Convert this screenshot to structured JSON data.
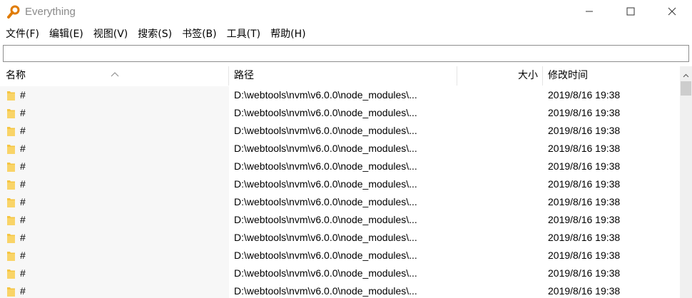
{
  "window": {
    "title": "Everything",
    "icon": "magnifier-app-icon"
  },
  "menu": {
    "items": [
      {
        "label": "文件(F)"
      },
      {
        "label": "编辑(E)"
      },
      {
        "label": "视图(V)"
      },
      {
        "label": "搜索(S)"
      },
      {
        "label": "书签(B)"
      },
      {
        "label": "工具(T)"
      },
      {
        "label": "帮助(H)"
      }
    ]
  },
  "search": {
    "value": "",
    "placeholder": ""
  },
  "columns": {
    "name": "名称",
    "path": "路径",
    "size": "大小",
    "date": "修改时间",
    "sorted_by": "name",
    "sort_direction": "ascending"
  },
  "rows": [
    {
      "name": "#",
      "path": "D:\\webtools\\nvm\\v6.0.0\\node_modules\\...",
      "size": "",
      "date": "2019/8/16 19:38"
    },
    {
      "name": "#",
      "path": "D:\\webtools\\nvm\\v6.0.0\\node_modules\\...",
      "size": "",
      "date": "2019/8/16 19:38"
    },
    {
      "name": "#",
      "path": "D:\\webtools\\nvm\\v6.0.0\\node_modules\\...",
      "size": "",
      "date": "2019/8/16 19:38"
    },
    {
      "name": "#",
      "path": "D:\\webtools\\nvm\\v6.0.0\\node_modules\\...",
      "size": "",
      "date": "2019/8/16 19:38"
    },
    {
      "name": "#",
      "path": "D:\\webtools\\nvm\\v6.0.0\\node_modules\\...",
      "size": "",
      "date": "2019/8/16 19:38"
    },
    {
      "name": "#",
      "path": "D:\\webtools\\nvm\\v6.0.0\\node_modules\\...",
      "size": "",
      "date": "2019/8/16 19:38"
    },
    {
      "name": "#",
      "path": "D:\\webtools\\nvm\\v6.0.0\\node_modules\\...",
      "size": "",
      "date": "2019/8/16 19:38"
    },
    {
      "name": "#",
      "path": "D:\\webtools\\nvm\\v6.0.0\\node_modules\\...",
      "size": "",
      "date": "2019/8/16 19:38"
    },
    {
      "name": "#",
      "path": "D:\\webtools\\nvm\\v6.0.0\\node_modules\\...",
      "size": "",
      "date": "2019/8/16 19:38"
    },
    {
      "name": "#",
      "path": "D:\\webtools\\nvm\\v6.0.0\\node_modules\\...",
      "size": "",
      "date": "2019/8/16 19:38"
    },
    {
      "name": "#",
      "path": "D:\\webtools\\nvm\\v6.0.0\\node_modules\\...",
      "size": "",
      "date": "2019/8/16 19:38"
    },
    {
      "name": "#",
      "path": "D:\\webtools\\nvm\\v6.0.0\\node_modules\\...",
      "size": "",
      "date": "2019/8/16 19:38"
    }
  ],
  "colors": {
    "folder": "#f5c542",
    "app_icon": "#e07b00",
    "title_text": "#8a8a8a",
    "name_column_bg": "#f7f7f7",
    "scrollbar_thumb": "#cdcdcd"
  }
}
